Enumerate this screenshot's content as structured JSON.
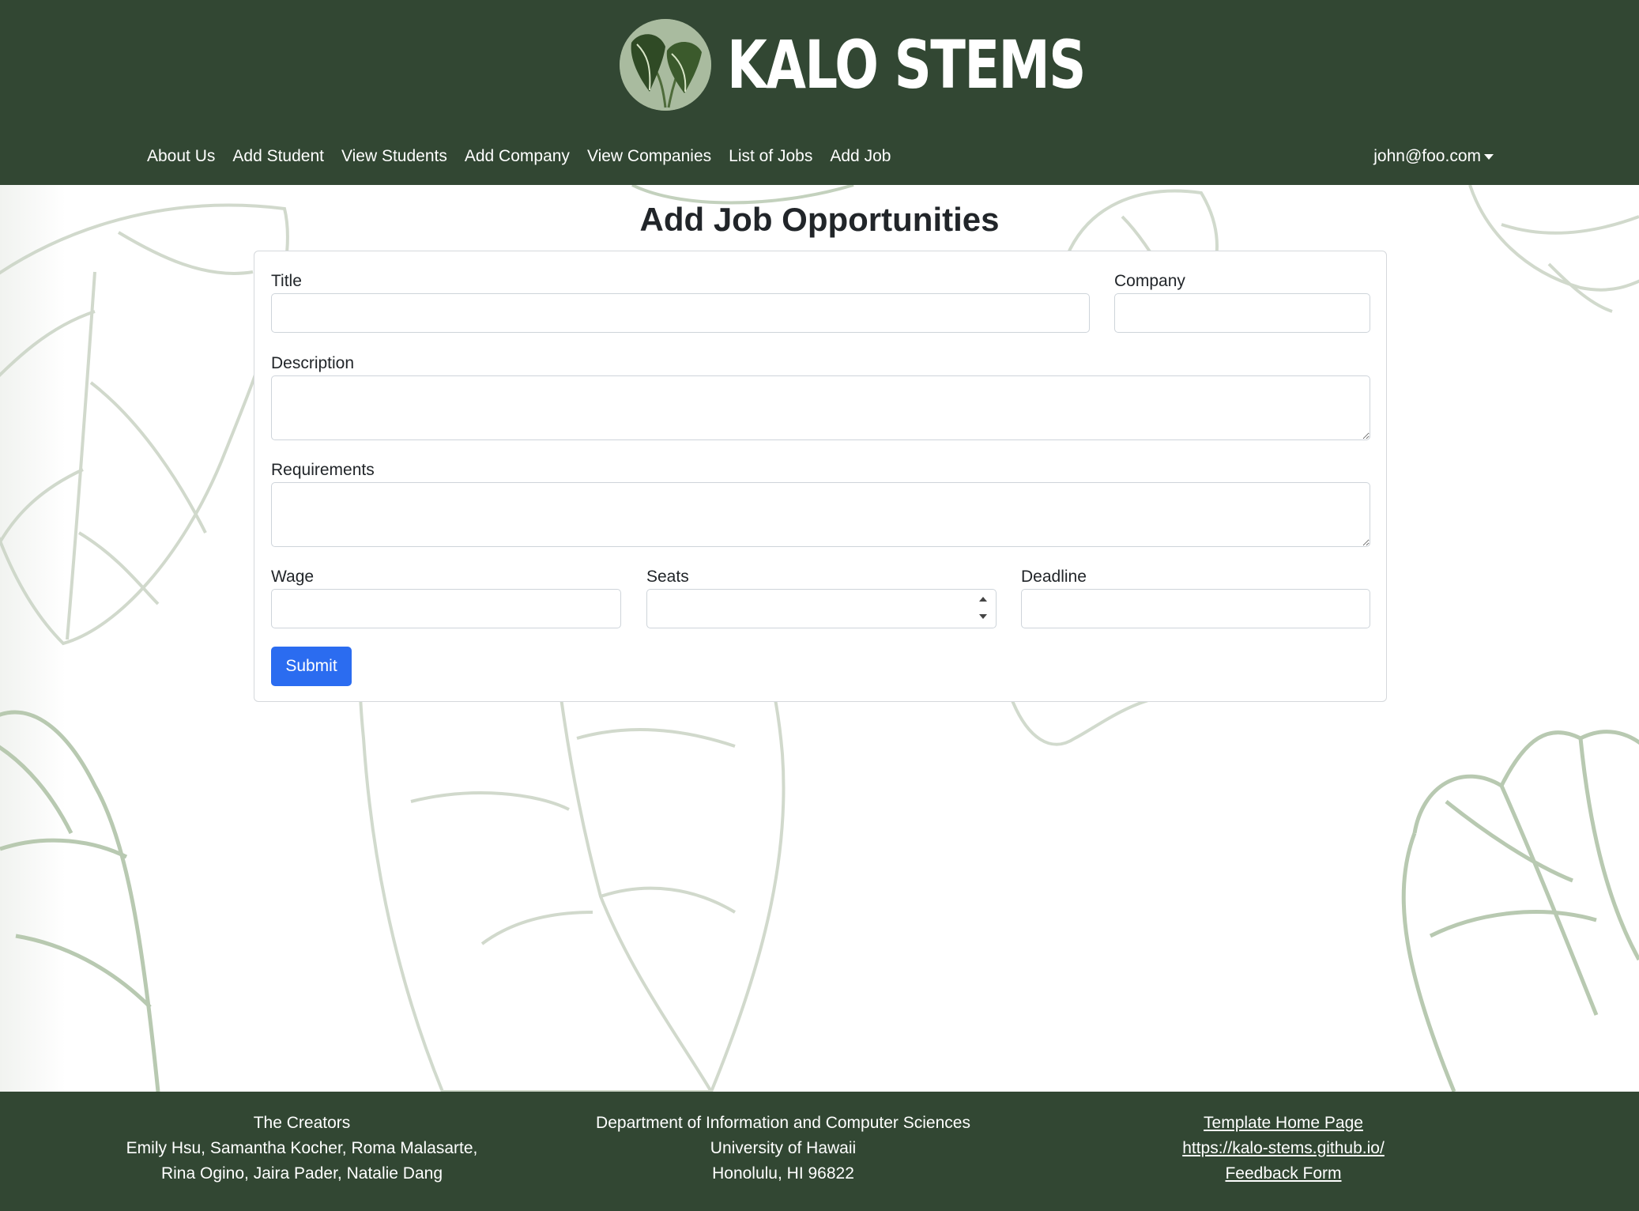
{
  "brand": {
    "name": "KALO STEMS",
    "logo_icon": "kalo-leaf-logo-icon"
  },
  "nav": {
    "items": [
      {
        "label": "About Us"
      },
      {
        "label": "Add Student"
      },
      {
        "label": "View Students"
      },
      {
        "label": "Add Company"
      },
      {
        "label": "View Companies"
      },
      {
        "label": "List of Jobs"
      },
      {
        "label": "Add Job"
      }
    ],
    "user": "john@foo.com"
  },
  "page": {
    "title": "Add Job Opportunities"
  },
  "form": {
    "title_label": "Title",
    "title_value": "",
    "company_label": "Company",
    "company_value": "",
    "description_label": "Description",
    "description_value": "",
    "requirements_label": "Requirements",
    "requirements_value": "",
    "wage_label": "Wage",
    "wage_value": "",
    "seats_label": "Seats",
    "seats_value": "",
    "deadline_label": "Deadline",
    "deadline_value": "",
    "submit_label": "Submit"
  },
  "footer": {
    "creators": {
      "heading": "The Creators",
      "line1": "Emily Hsu, Samantha Kocher, Roma Malasarte,",
      "line2": "Rina Ogino, Jaira Pader, Natalie Dang"
    },
    "address": {
      "line1": "Department of Information and Computer Sciences",
      "line2": "University of Hawaii",
      "line3": "Honolulu, HI 96822"
    },
    "links": {
      "template": "Template Home Page",
      "site": "https://kalo-stems.github.io/",
      "feedback": "Feedback Form"
    }
  },
  "colors": {
    "header_bg": "#324733",
    "button_primary": "#2b6cf0",
    "leaf_outline": "#b5c7ad"
  }
}
